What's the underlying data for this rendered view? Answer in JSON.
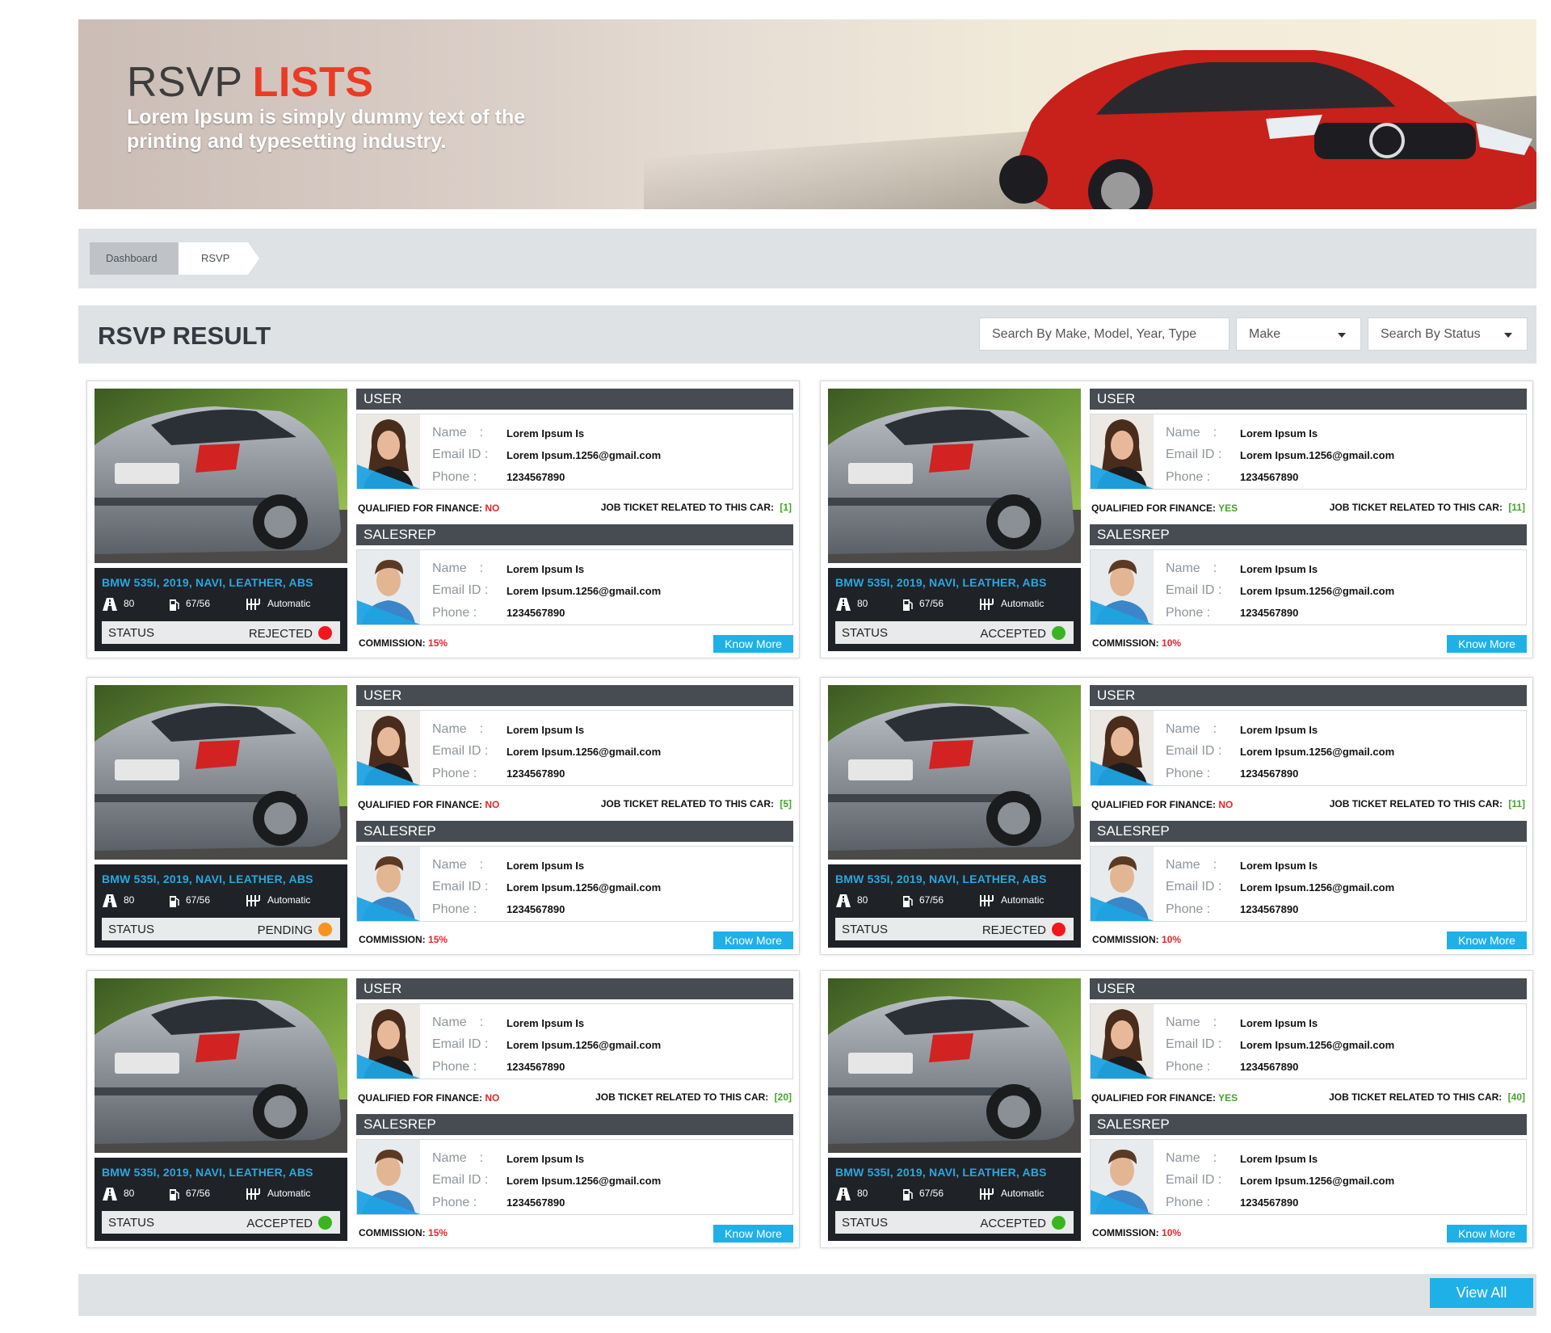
{
  "hero": {
    "title_main": "RSVP",
    "title_highlight": "LISTS",
    "subtitle_line1": "Lorem Ipsum is simply dummy text of the",
    "subtitle_line2": "printing and typesetting industry."
  },
  "breadcrumb": {
    "items": [
      "Dashboard",
      "RSVP"
    ]
  },
  "result": {
    "title": "RSVP RESULT",
    "search_placeholder": "Search By Make, Model, Year, Type",
    "make_select": "Make",
    "status_select": "Search By Status"
  },
  "labels": {
    "user": "USER",
    "salesrep": "SALESREP",
    "name": "Name",
    "email": "Email ID :",
    "phone": "Phone :",
    "colon": ":",
    "qualified": "QUALIFIED FOR FINANCE:",
    "job_ticket": "JOB TICKET RELATED TO THIS CAR:",
    "commission": "COMMISSION:",
    "status": "STATUS",
    "know_more": "Know More"
  },
  "colors": {
    "rejected": "#f5151c",
    "accepted": "#39b520",
    "pending": "#f7931e",
    "accent": "#1fb0e8"
  },
  "cards": [
    {
      "car": "BMW 535I, 2019, NAVI, LEATHER, ABS",
      "spec_road": "80",
      "spec_fuel": "67/56",
      "spec_trans": "Automatic",
      "status": "REJECTED",
      "status_color": "rejected",
      "user": {
        "name": "Lorem Ipsum Is",
        "email": "Lorem Ipsum.1256@gmail.com",
        "phone": "1234567890"
      },
      "qualified": "NO",
      "job_ticket": "[1]",
      "salesrep": {
        "name": "Lorem Ipsum Is",
        "email": "Lorem Ipsum.1256@gmail.com",
        "phone": "1234567890"
      },
      "commission": "15%"
    },
    {
      "car": "BMW 535I, 2019, NAVI, LEATHER, ABS",
      "spec_road": "80",
      "spec_fuel": "67/56",
      "spec_trans": "Automatic",
      "status": "ACCEPTED",
      "status_color": "accepted",
      "user": {
        "name": "Lorem Ipsum Is",
        "email": "Lorem Ipsum.1256@gmail.com",
        "phone": "1234567890"
      },
      "qualified": "YES",
      "job_ticket": "[11]",
      "salesrep": {
        "name": "Lorem Ipsum Is",
        "email": "Lorem Ipsum.1256@gmail.com",
        "phone": "1234567890"
      },
      "commission": "10%"
    },
    {
      "car": "BMW 535I, 2019, NAVI, LEATHER, ABS",
      "spec_road": "80",
      "spec_fuel": "67/56",
      "spec_trans": "Automatic",
      "status": "PENDING",
      "status_color": "pending",
      "user": {
        "name": "Lorem Ipsum Is",
        "email": "Lorem Ipsum.1256@gmail.com",
        "phone": "1234567890"
      },
      "qualified": "NO",
      "job_ticket": "[5]",
      "salesrep": {
        "name": "Lorem Ipsum Is",
        "email": "Lorem Ipsum.1256@gmail.com",
        "phone": "1234567890"
      },
      "commission": "15%"
    },
    {
      "car": "BMW 535I, 2019, NAVI, LEATHER, ABS",
      "spec_road": "80",
      "spec_fuel": "67/56",
      "spec_trans": "Automatic",
      "status": "REJECTED",
      "status_color": "rejected",
      "user": {
        "name": "Lorem Ipsum Is",
        "email": "Lorem Ipsum.1256@gmail.com",
        "phone": "1234567890"
      },
      "qualified": "NO",
      "job_ticket": "[11]",
      "salesrep": {
        "name": "Lorem Ipsum Is",
        "email": "Lorem Ipsum.1256@gmail.com",
        "phone": "1234567890"
      },
      "commission": "10%"
    },
    {
      "car": "BMW 535I, 2019, NAVI, LEATHER, ABS",
      "spec_road": "80",
      "spec_fuel": "67/56",
      "spec_trans": "Automatic",
      "status": "ACCEPTED",
      "status_color": "accepted",
      "user": {
        "name": "Lorem Ipsum Is",
        "email": "Lorem Ipsum.1256@gmail.com",
        "phone": "1234567890"
      },
      "qualified": "NO",
      "job_ticket": "[20]",
      "salesrep": {
        "name": "Lorem Ipsum Is",
        "email": "Lorem Ipsum.1256@gmail.com",
        "phone": "1234567890"
      },
      "commission": "15%"
    },
    {
      "car": "BMW 535I, 2019, NAVI, LEATHER, ABS",
      "spec_road": "80",
      "spec_fuel": "67/56",
      "spec_trans": "Automatic",
      "status": "ACCEPTED",
      "status_color": "accepted",
      "user": {
        "name": "Lorem Ipsum Is",
        "email": "Lorem Ipsum.1256@gmail.com",
        "phone": "1234567890"
      },
      "qualified": "YES",
      "job_ticket": "[40]",
      "salesrep": {
        "name": "Lorem Ipsum Is",
        "email": "Lorem Ipsum.1256@gmail.com",
        "phone": "1234567890"
      },
      "commission": "10%"
    }
  ],
  "footer": {
    "view_all": "View All"
  }
}
